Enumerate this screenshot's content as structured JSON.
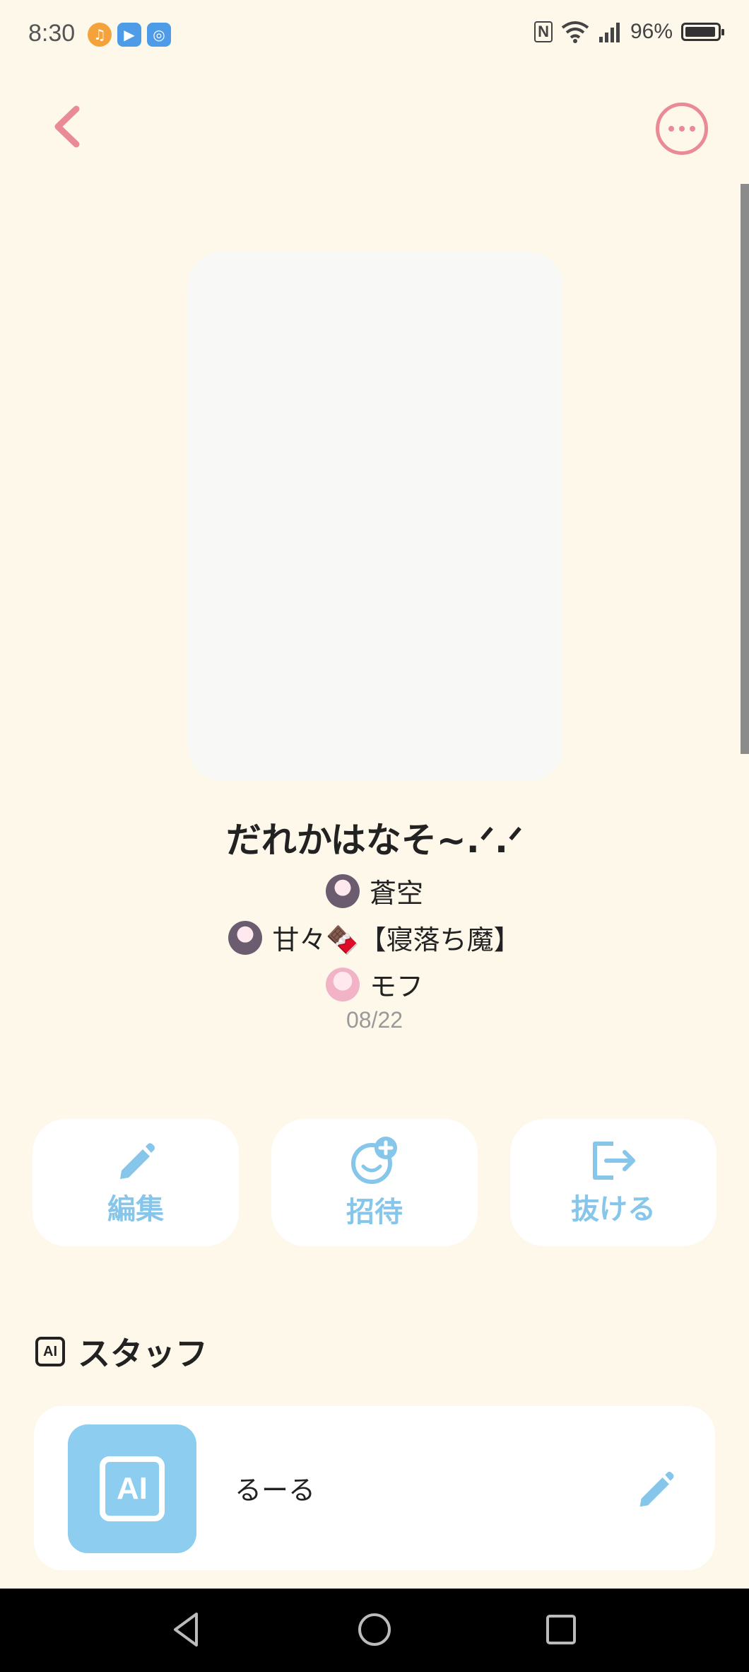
{
  "status_bar": {
    "time": "8:30",
    "notification_icons": [
      "music-app-icon",
      "video-app-icon",
      "browser-app-icon"
    ],
    "battery": "96%"
  },
  "header": {
    "back_icon": "chevron-left-icon",
    "more_icon": "more-options-icon"
  },
  "room": {
    "title": "だれかはなそ~.ᐟ.ᐟ",
    "members": [
      {
        "name": "蒼空"
      },
      {
        "name": "甘々🍫【寝落ち魔】"
      },
      {
        "name": "モフ"
      }
    ],
    "date": "08/22"
  },
  "actions": [
    {
      "label": "編集",
      "icon": "pencil-icon"
    },
    {
      "label": "招待",
      "icon": "invite-smile-icon"
    },
    {
      "label": "抜ける",
      "icon": "exit-icon"
    }
  ],
  "staff_section": {
    "badge": "AI",
    "title": "スタッフ",
    "staff": [
      {
        "icon_text": "AI",
        "name": "るーる"
      }
    ]
  },
  "colors": {
    "background": "#fdf8ea",
    "accent_pink": "#ea8a96",
    "accent_blue": "#85c6ea"
  }
}
